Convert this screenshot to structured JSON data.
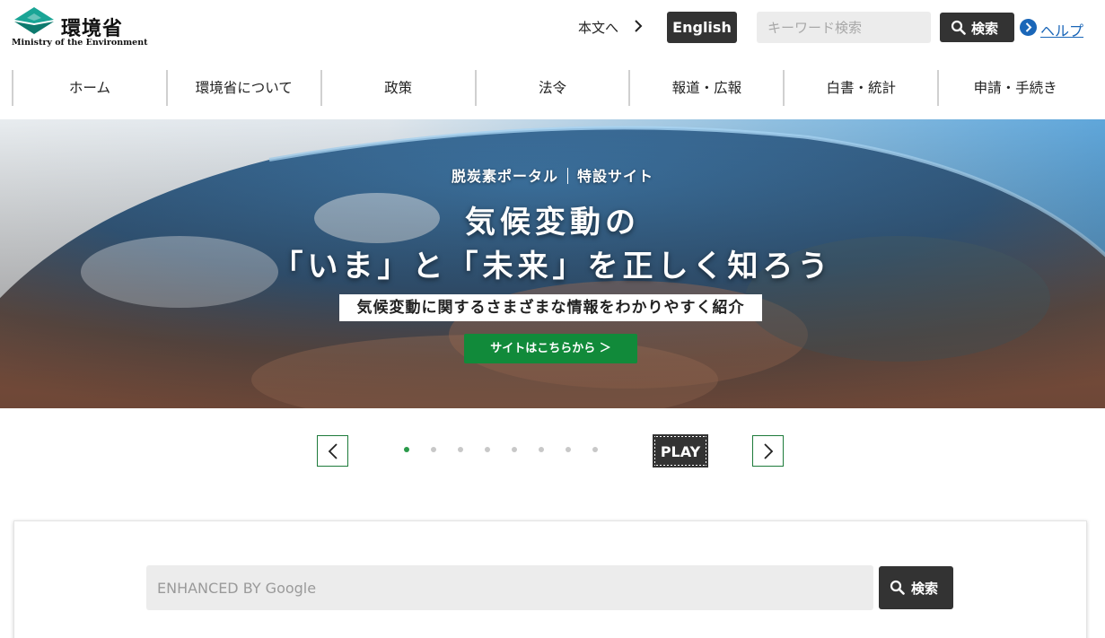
{
  "header": {
    "logo_text_jp": "環境省",
    "logo_text_en": "Ministry of the Environment",
    "skip_link": "本文へ",
    "english_button": "English",
    "search_placeholder": "キーワード検索",
    "search_button": "検索",
    "help_link": "ヘルプ"
  },
  "nav": {
    "items": [
      {
        "label": "ホーム"
      },
      {
        "label": "環境省について"
      },
      {
        "label": "政策"
      },
      {
        "label": "法令"
      },
      {
        "label": "報道・広報"
      },
      {
        "label": "白書・統計"
      },
      {
        "label": "申請・手続き"
      }
    ]
  },
  "hero": {
    "portal_label": "脱炭素ポータル",
    "special_label": "特設サイト",
    "title_line1": "気候変動の",
    "title_line2": "「いま」と「未来」を正しく知ろう",
    "subtitle": "気候変動に関するさまざまな情報をわかりやすく紹介",
    "cta_label": "サイトはこちらから ＞"
  },
  "carousel": {
    "slide_count": 8,
    "active_index": 0,
    "play_label": "PLAY"
  },
  "site_search": {
    "placeholder": "ENHANCED BY Google",
    "button": "検索"
  },
  "colors": {
    "brand_green": "#118a3a",
    "dark_button": "#333333",
    "link_blue": "#1a66b8",
    "logo_teal": "#1aa596"
  }
}
